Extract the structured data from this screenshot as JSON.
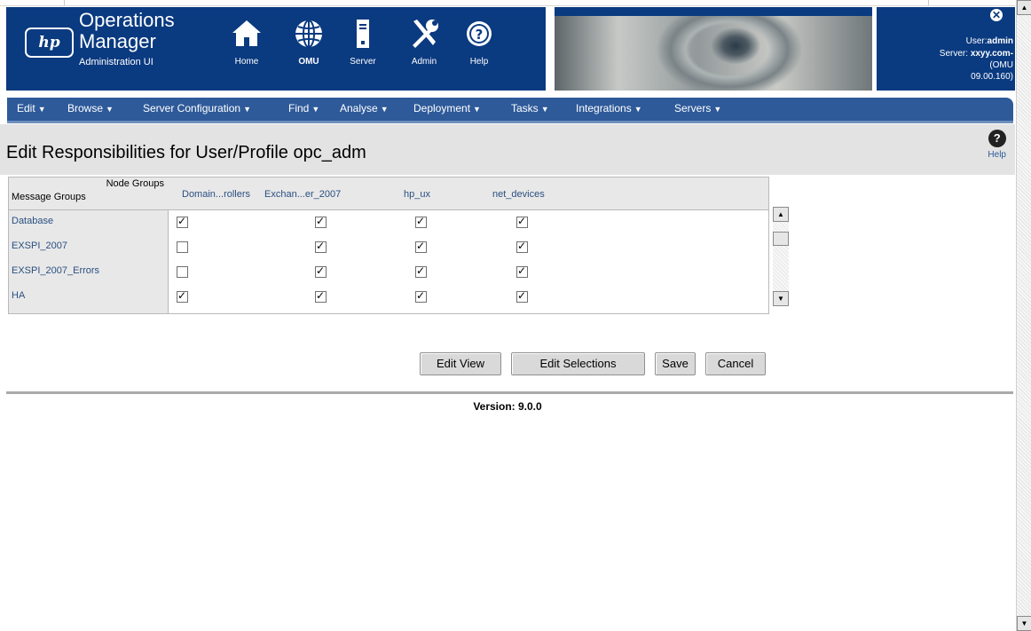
{
  "header": {
    "logo": "hp",
    "title_line1": "Operations",
    "title_line2": "Manager",
    "subtitle": "Administration UI",
    "nav": [
      {
        "label": "Home",
        "icon": "home-icon"
      },
      {
        "label": "OMU",
        "icon": "globe-icon"
      },
      {
        "label": "Server",
        "icon": "server-icon"
      },
      {
        "label": "Admin",
        "icon": "tools-icon"
      },
      {
        "label": "Help",
        "icon": "help-icon"
      }
    ],
    "user_label": "User:",
    "user_value": "admin",
    "server_label": "Server:",
    "server_value": "xxyy.com-",
    "server_line2": "(OMU",
    "server_line3": "09.00.160)"
  },
  "menubar": {
    "items": [
      "Edit",
      "Browse",
      "Server Configuration",
      "Find",
      "Analyse",
      "Deployment",
      "Tasks",
      "Integrations",
      "Servers"
    ]
  },
  "page": {
    "title": "Edit Responsibilities for User/Profile opc_adm",
    "help_label": "Help"
  },
  "grid": {
    "corner_top": "Node Groups",
    "corner_bottom": "Message Groups",
    "columns": [
      "Domain...rollers",
      "Exchan...er_2007",
      "hp_ux",
      "net_devices"
    ],
    "rows": [
      {
        "label": "Database",
        "checked": [
          true,
          true,
          true,
          true
        ]
      },
      {
        "label": "EXSPI_2007",
        "checked": [
          false,
          true,
          true,
          true
        ]
      },
      {
        "label": "EXSPI_2007_Errors",
        "checked": [
          false,
          true,
          true,
          true
        ]
      },
      {
        "label": "HA",
        "checked": [
          true,
          true,
          true,
          true
        ]
      }
    ]
  },
  "buttons": {
    "edit_view": "Edit View",
    "edit_selections": "Edit Selections",
    "save": "Save",
    "cancel": "Cancel"
  },
  "footer": {
    "version": "Version: 9.0.0"
  },
  "colors": {
    "brand_blue": "#0a3a80",
    "menubar_blue": "#2e5a9a",
    "link_blue": "#2a4f82"
  }
}
